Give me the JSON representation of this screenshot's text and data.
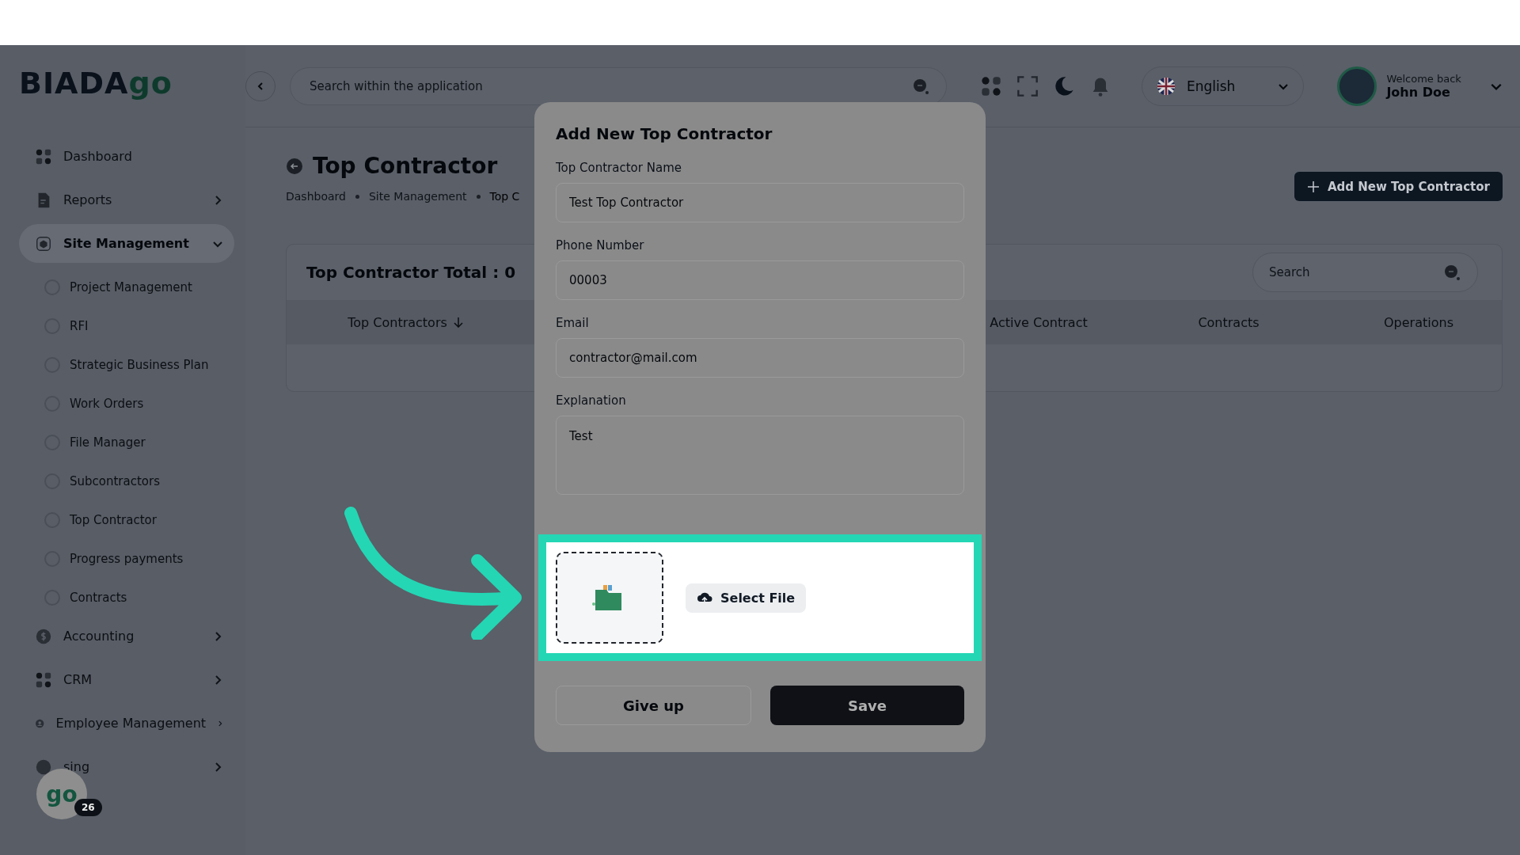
{
  "header": {
    "search": {
      "placeholder": "Search within the application"
    },
    "language": "English",
    "user": {
      "greeting": "Welcome back",
      "name": "John Doe"
    }
  },
  "sidebar": {
    "logo": {
      "dark": "BIADA",
      "green": "go"
    },
    "items": [
      {
        "label": "Dashboard",
        "selected": false
      },
      {
        "label": "Reports",
        "selected": false,
        "expanded": false
      },
      {
        "label": "Site Management",
        "selected": true,
        "expanded": true,
        "children": [
          {
            "label": "Project Management",
            "selected": false
          },
          {
            "label": "RFI",
            "selected": false
          },
          {
            "label": "Strategic Business Plan",
            "selected": false
          },
          {
            "label": "Work Orders",
            "selected": false
          },
          {
            "label": "File Manager",
            "selected": false
          },
          {
            "label": "Subcontractors",
            "selected": false
          },
          {
            "label": "Top Contractor",
            "selected": false
          },
          {
            "label": "Progress payments",
            "selected": false
          },
          {
            "label": "Contracts",
            "selected": false
          }
        ]
      },
      {
        "label": "Accounting",
        "selected": false,
        "expanded": false
      },
      {
        "label": "CRM",
        "selected": false,
        "expanded": false
      },
      {
        "label": "Employee Management",
        "selected": false,
        "expanded": false
      },
      {
        "label": "sing",
        "selected": false,
        "expanded": false
      }
    ],
    "helper": {
      "logo": "go",
      "badge": "26"
    }
  },
  "page": {
    "title": "Top Contractor",
    "breadcrumb": [
      "Dashboard",
      "Site Management",
      "Top C"
    ],
    "add_button": "Add New Top Contractor",
    "card": {
      "total": "Top Contractor Total : 0",
      "search": {
        "placeholder": "Search"
      },
      "columns": [
        "Top Contractors",
        "Active Contract",
        "Contracts",
        "Operations"
      ]
    }
  },
  "modal": {
    "title": "Add New Top Contractor",
    "fields": [
      {
        "label": "Top Contractor Name",
        "value": "Test Top Contractor",
        "kind": "input"
      },
      {
        "label": "Phone Number",
        "value": "00003",
        "kind": "input"
      },
      {
        "label": "Email",
        "value": "contractor@mail.com",
        "kind": "input"
      },
      {
        "label": "Explanation",
        "value": "Test",
        "kind": "textarea"
      }
    ],
    "upload": {
      "button": "Select File"
    },
    "buttons": [
      {
        "label": "Give up",
        "kind": "secondary"
      },
      {
        "label": "Save",
        "kind": "primary"
      }
    ]
  }
}
